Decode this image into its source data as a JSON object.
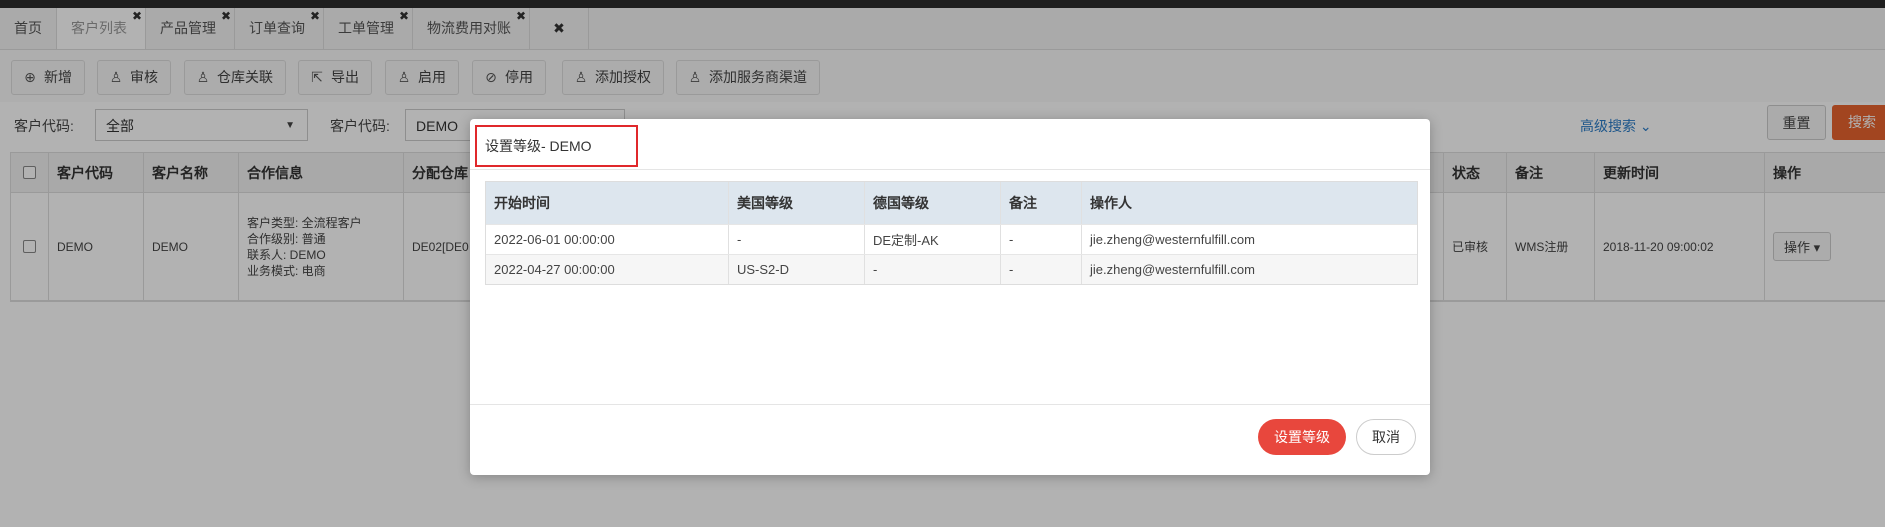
{
  "tabs": [
    {
      "label": "首页",
      "close": ""
    },
    {
      "label": "客户列表",
      "close": "✖"
    },
    {
      "label": "产品管理",
      "close": "✖"
    },
    {
      "label": "订单查询",
      "close": "✖"
    },
    {
      "label": "工单管理",
      "close": "✖"
    },
    {
      "label": "物流费用对账",
      "close": "✖"
    }
  ],
  "tab_close_all": "✖",
  "toolbar": [
    {
      "label": "新增",
      "icon": "⊕"
    },
    {
      "label": "审核",
      "icon": "♙"
    },
    {
      "label": "仓库关联",
      "icon": "♙"
    },
    {
      "label": "导出",
      "icon": "⇱"
    },
    {
      "label": "启用",
      "icon": "♙"
    },
    {
      "label": "停用",
      "icon": "⊘"
    },
    {
      "label": "添加授权",
      "icon": "♙"
    },
    {
      "label": "添加服务商渠道",
      "icon": "♙"
    }
  ],
  "filters": {
    "customer_code_label": "客户代码:",
    "customer_code_select": "全部",
    "customer_code2_label": "客户代码:",
    "customer_code2_value": "DEMO",
    "advanced_search": "高级搜索",
    "reset": "重置",
    "search": "搜索",
    "caret": "▼"
  },
  "grid": {
    "headers": {
      "code": "客户代码",
      "name": "客户名称",
      "coop": "合作信息",
      "warehouse": "分配仓库",
      "status": "状态",
      "remark": "备注",
      "updated": "更新时间",
      "action": "操作"
    },
    "rows": [
      {
        "code": "DEMO",
        "name": "DEMO",
        "coop": [
          "客户类型: 全流程客户",
          "合作级别: 普通",
          "联系人: DEMO",
          "业务模式: 电商"
        ],
        "warehouse": "DE02[DE0",
        "status": "已审核",
        "remark": "WMS注册",
        "updated": "2018-11-20 09:00:02",
        "action": "操作 ▾"
      }
    ]
  },
  "modal": {
    "title": "设置等级- DEMO",
    "columns": [
      "开始时间",
      "美国等级",
      "德国等级",
      "备注",
      "操作人"
    ],
    "rows": [
      [
        "2022-06-01 00:00:00",
        "-",
        "DE定制-AK",
        "-",
        "jie.zheng@westernfulfill.com"
      ],
      [
        "2022-04-27 00:00:00",
        "US-S2-D",
        "-",
        "-",
        "jie.zheng@westernfulfill.com"
      ]
    ],
    "confirm": "设置等级",
    "cancel": "取消"
  },
  "colors": {
    "accent": "#e8473d",
    "search": "#e8632e",
    "highlight": "#e0282b",
    "link": "#2a7cc7"
  }
}
